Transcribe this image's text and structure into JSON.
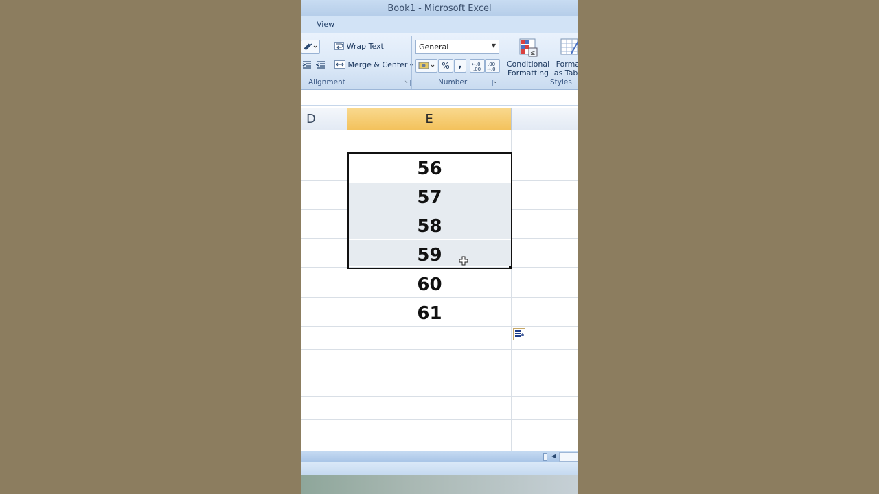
{
  "window": {
    "title": "Book1 - Microsoft Excel"
  },
  "ribbon": {
    "tab_view": "View",
    "alignment": {
      "wrap_text": "Wrap Text",
      "merge_center": "Merge & Center",
      "group_label": "Alignment"
    },
    "number": {
      "format_value": "General",
      "percent": "%",
      "comma": ",",
      "group_label": "Number"
    },
    "styles": {
      "conditional_line1": "Conditional",
      "conditional_line2": "Formatting",
      "format_table_line1": "Format",
      "format_table_line2": "as Table",
      "group_label": "Styles"
    }
  },
  "sheet": {
    "columns": [
      "D",
      "E"
    ],
    "selected_column": "E",
    "values": [
      "56",
      "57",
      "58",
      "59",
      "60",
      "61"
    ]
  },
  "colors": {
    "selected_header": "#f3c25c",
    "selection_fill": "#e6ebf0",
    "ribbon": "#dbe8f7"
  }
}
